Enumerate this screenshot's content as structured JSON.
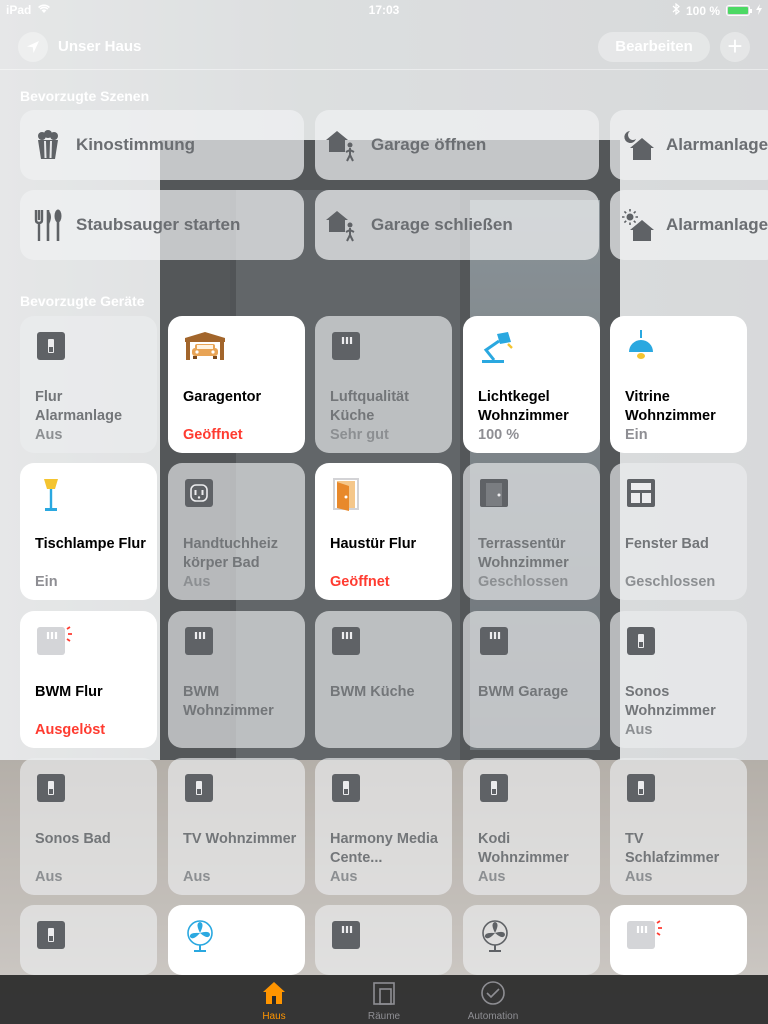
{
  "status": {
    "carrier": "iPad",
    "time": "17:03",
    "battery": "100 %"
  },
  "nav": {
    "title": "Unser Haus",
    "edit": "Bearbeiten",
    "add": "+"
  },
  "sections": {
    "scenes": "Bevorzugte Szenen",
    "devices": "Bevorzugte Geräte"
  },
  "scenes": [
    {
      "label": "Kinostimmung",
      "icon": "popcorn-icon"
    },
    {
      "label": "Garage öffnen",
      "icon": "house-person-icon"
    },
    {
      "label": "Alarmanlage",
      "icon": "house-moon-icon"
    },
    {
      "label": "Staubsauger starten",
      "icon": "fork-knife-icon"
    },
    {
      "label": "Garage schließen",
      "icon": "house-person-icon"
    },
    {
      "label": "Alarmanlage",
      "icon": "house-sun-icon"
    }
  ],
  "devices": [
    {
      "name": "Flur Alarmanlage",
      "status": "Aus",
      "on": false,
      "icon": "switch-icon"
    },
    {
      "name": "Garagentor",
      "status": "Geöffnet",
      "on": true,
      "alert": true,
      "icon": "garage-icon"
    },
    {
      "name": "Luftqualität Küche",
      "status": "Sehr gut",
      "on": false,
      "icon": "sensor-icon"
    },
    {
      "name": "Lichtkegel Wohnzimmer",
      "status": "100 %",
      "on": true,
      "icon": "desk-lamp-icon"
    },
    {
      "name": "Vitrine Wohnzimmer",
      "status": "Ein",
      "on": true,
      "icon": "pendant-lamp-icon"
    },
    {
      "name": "Tischlampe Flur",
      "status": "Ein",
      "on": true,
      "icon": "floor-lamp-icon"
    },
    {
      "name": "Handtuchheiz körper Bad",
      "status": "Aus",
      "on": false,
      "icon": "outlet-icon"
    },
    {
      "name": "Haustür Flur",
      "status": "Geöffnet",
      "on": true,
      "alert": true,
      "icon": "door-open-icon"
    },
    {
      "name": "Terrassentür Wohnzimmer",
      "status": "Geschlossen",
      "on": false,
      "icon": "door-closed-icon"
    },
    {
      "name": "Fenster Bad",
      "status": "Geschlossen",
      "on": false,
      "icon": "window-icon"
    },
    {
      "name": "BWM Flur",
      "status": "Ausgelöst",
      "on": true,
      "alert": true,
      "icon": "motion-sensor-icon"
    },
    {
      "name": "BWM Wohnzimmer",
      "status": "",
      "on": false,
      "icon": "sensor-icon"
    },
    {
      "name": "BWM Küche",
      "status": "",
      "on": false,
      "icon": "sensor-icon"
    },
    {
      "name": "BWM Garage",
      "status": "",
      "on": false,
      "icon": "sensor-icon"
    },
    {
      "name": "Sonos Wohnzimmer",
      "status": "Aus",
      "on": false,
      "icon": "switch-icon"
    },
    {
      "name": "Sonos Bad",
      "status": "Aus",
      "on": false,
      "icon": "switch-icon"
    },
    {
      "name": "TV Wohnzimmer",
      "status": "Aus",
      "on": false,
      "icon": "switch-icon"
    },
    {
      "name": "Harmony Media Cente...",
      "status": "Aus",
      "on": false,
      "icon": "switch-icon"
    },
    {
      "name": "Kodi Wohnzimmer",
      "status": "Aus",
      "on": false,
      "icon": "switch-icon"
    },
    {
      "name": "TV Schlafzimmer",
      "status": "Aus",
      "on": false,
      "icon": "switch-icon"
    },
    {
      "name": "",
      "status": "",
      "on": false,
      "icon": "switch-icon"
    },
    {
      "name": "",
      "status": "",
      "on": true,
      "icon": "fan-icon"
    },
    {
      "name": "",
      "status": "",
      "on": false,
      "icon": "sensor-icon"
    },
    {
      "name": "",
      "status": "",
      "on": false,
      "icon": "fan-icon"
    },
    {
      "name": "",
      "status": "",
      "on": true,
      "icon": "motion-sensor-icon"
    }
  ],
  "tabs": [
    {
      "label": "Haus",
      "active": true,
      "icon": "house-icon"
    },
    {
      "label": "Räume",
      "active": false,
      "icon": "rooms-icon"
    },
    {
      "label": "Automation",
      "active": false,
      "icon": "clock-icon"
    }
  ],
  "colors": {
    "accent": "#ff9500",
    "alert": "#ff3b30",
    "battery": "#4cd964"
  }
}
